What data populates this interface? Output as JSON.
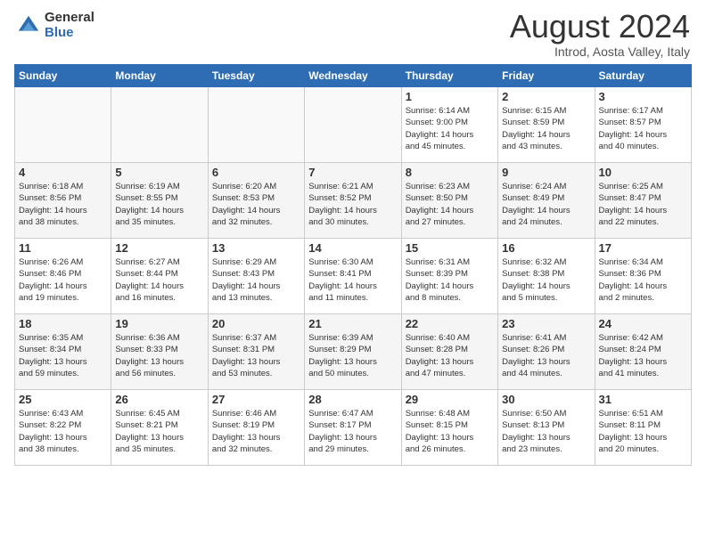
{
  "header": {
    "logo_general": "General",
    "logo_blue": "Blue",
    "month_year": "August 2024",
    "location": "Introd, Aosta Valley, Italy"
  },
  "days_of_week": [
    "Sunday",
    "Monday",
    "Tuesday",
    "Wednesday",
    "Thursday",
    "Friday",
    "Saturday"
  ],
  "weeks": [
    {
      "row_shaded": false,
      "days": [
        {
          "num": "",
          "info": ""
        },
        {
          "num": "",
          "info": ""
        },
        {
          "num": "",
          "info": ""
        },
        {
          "num": "",
          "info": ""
        },
        {
          "num": "1",
          "info": "Sunrise: 6:14 AM\nSunset: 9:00 PM\nDaylight: 14 hours\nand 45 minutes."
        },
        {
          "num": "2",
          "info": "Sunrise: 6:15 AM\nSunset: 8:59 PM\nDaylight: 14 hours\nand 43 minutes."
        },
        {
          "num": "3",
          "info": "Sunrise: 6:17 AM\nSunset: 8:57 PM\nDaylight: 14 hours\nand 40 minutes."
        }
      ]
    },
    {
      "row_shaded": true,
      "days": [
        {
          "num": "4",
          "info": "Sunrise: 6:18 AM\nSunset: 8:56 PM\nDaylight: 14 hours\nand 38 minutes."
        },
        {
          "num": "5",
          "info": "Sunrise: 6:19 AM\nSunset: 8:55 PM\nDaylight: 14 hours\nand 35 minutes."
        },
        {
          "num": "6",
          "info": "Sunrise: 6:20 AM\nSunset: 8:53 PM\nDaylight: 14 hours\nand 32 minutes."
        },
        {
          "num": "7",
          "info": "Sunrise: 6:21 AM\nSunset: 8:52 PM\nDaylight: 14 hours\nand 30 minutes."
        },
        {
          "num": "8",
          "info": "Sunrise: 6:23 AM\nSunset: 8:50 PM\nDaylight: 14 hours\nand 27 minutes."
        },
        {
          "num": "9",
          "info": "Sunrise: 6:24 AM\nSunset: 8:49 PM\nDaylight: 14 hours\nand 24 minutes."
        },
        {
          "num": "10",
          "info": "Sunrise: 6:25 AM\nSunset: 8:47 PM\nDaylight: 14 hours\nand 22 minutes."
        }
      ]
    },
    {
      "row_shaded": false,
      "days": [
        {
          "num": "11",
          "info": "Sunrise: 6:26 AM\nSunset: 8:46 PM\nDaylight: 14 hours\nand 19 minutes."
        },
        {
          "num": "12",
          "info": "Sunrise: 6:27 AM\nSunset: 8:44 PM\nDaylight: 14 hours\nand 16 minutes."
        },
        {
          "num": "13",
          "info": "Sunrise: 6:29 AM\nSunset: 8:43 PM\nDaylight: 14 hours\nand 13 minutes."
        },
        {
          "num": "14",
          "info": "Sunrise: 6:30 AM\nSunset: 8:41 PM\nDaylight: 14 hours\nand 11 minutes."
        },
        {
          "num": "15",
          "info": "Sunrise: 6:31 AM\nSunset: 8:39 PM\nDaylight: 14 hours\nand 8 minutes."
        },
        {
          "num": "16",
          "info": "Sunrise: 6:32 AM\nSunset: 8:38 PM\nDaylight: 14 hours\nand 5 minutes."
        },
        {
          "num": "17",
          "info": "Sunrise: 6:34 AM\nSunset: 8:36 PM\nDaylight: 14 hours\nand 2 minutes."
        }
      ]
    },
    {
      "row_shaded": true,
      "days": [
        {
          "num": "18",
          "info": "Sunrise: 6:35 AM\nSunset: 8:34 PM\nDaylight: 13 hours\nand 59 minutes."
        },
        {
          "num": "19",
          "info": "Sunrise: 6:36 AM\nSunset: 8:33 PM\nDaylight: 13 hours\nand 56 minutes."
        },
        {
          "num": "20",
          "info": "Sunrise: 6:37 AM\nSunset: 8:31 PM\nDaylight: 13 hours\nand 53 minutes."
        },
        {
          "num": "21",
          "info": "Sunrise: 6:39 AM\nSunset: 8:29 PM\nDaylight: 13 hours\nand 50 minutes."
        },
        {
          "num": "22",
          "info": "Sunrise: 6:40 AM\nSunset: 8:28 PM\nDaylight: 13 hours\nand 47 minutes."
        },
        {
          "num": "23",
          "info": "Sunrise: 6:41 AM\nSunset: 8:26 PM\nDaylight: 13 hours\nand 44 minutes."
        },
        {
          "num": "24",
          "info": "Sunrise: 6:42 AM\nSunset: 8:24 PM\nDaylight: 13 hours\nand 41 minutes."
        }
      ]
    },
    {
      "row_shaded": false,
      "days": [
        {
          "num": "25",
          "info": "Sunrise: 6:43 AM\nSunset: 8:22 PM\nDaylight: 13 hours\nand 38 minutes."
        },
        {
          "num": "26",
          "info": "Sunrise: 6:45 AM\nSunset: 8:21 PM\nDaylight: 13 hours\nand 35 minutes."
        },
        {
          "num": "27",
          "info": "Sunrise: 6:46 AM\nSunset: 8:19 PM\nDaylight: 13 hours\nand 32 minutes."
        },
        {
          "num": "28",
          "info": "Sunrise: 6:47 AM\nSunset: 8:17 PM\nDaylight: 13 hours\nand 29 minutes."
        },
        {
          "num": "29",
          "info": "Sunrise: 6:48 AM\nSunset: 8:15 PM\nDaylight: 13 hours\nand 26 minutes."
        },
        {
          "num": "30",
          "info": "Sunrise: 6:50 AM\nSunset: 8:13 PM\nDaylight: 13 hours\nand 23 minutes."
        },
        {
          "num": "31",
          "info": "Sunrise: 6:51 AM\nSunset: 8:11 PM\nDaylight: 13 hours\nand 20 minutes."
        }
      ]
    }
  ]
}
